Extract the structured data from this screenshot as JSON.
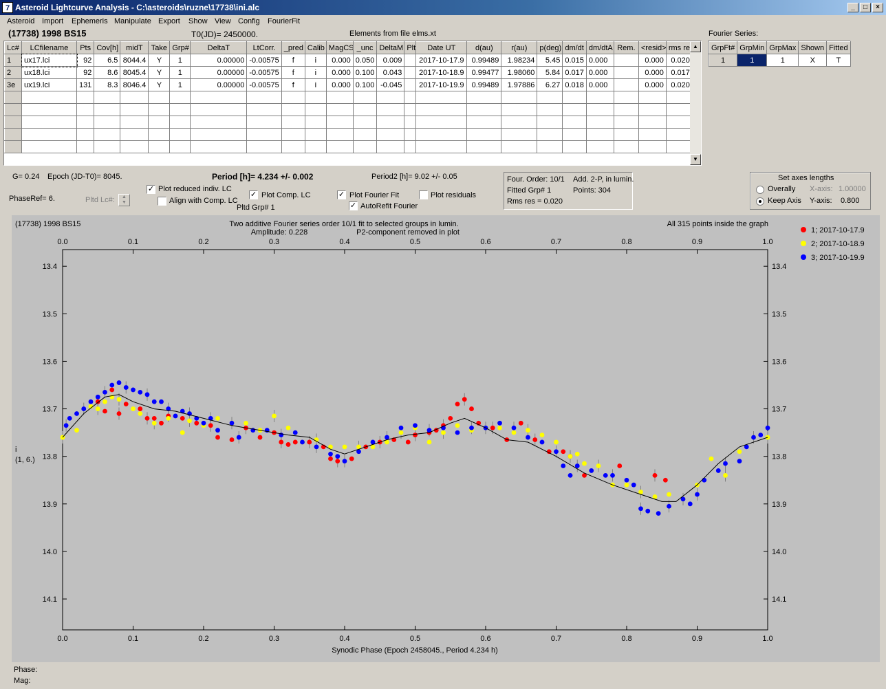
{
  "window": {
    "title": "Asteroid Lightcurve Analysis - C:\\asteroids\\ruzne\\17738\\ini.alc",
    "icon": "app-icon",
    "min": "_",
    "max": "□",
    "close": "×"
  },
  "menu": [
    "Asteroid",
    "Import",
    "Ephemeris",
    "Manipulate",
    "Export",
    "Show",
    "View",
    "Config",
    "FourierFit"
  ],
  "header": {
    "asteroid": "(17738) 1998 BS15",
    "t0": "T0(JD)= 2450000.",
    "elements": "Elements from file elms.xt",
    "fourier_series": "Fourier Series:"
  },
  "lc_table": {
    "columns": [
      "Lc#",
      "LCfilename",
      "Pts",
      "Cov[h]",
      "midT",
      "Take",
      "Grp#",
      "DeltaT",
      "LtCorr.",
      "_pred",
      "Calib",
      "MagCS",
      "_unc",
      "DeltaM",
      "Plt",
      "Date UT",
      "d(au)",
      "r(au)",
      "p(deg)",
      "dm/dt",
      "dm/dtA",
      "Rem.",
      "<resid>",
      "rms res"
    ],
    "rows": [
      [
        "1",
        "ux17.lci",
        "92",
        "6.5",
        "8044.4",
        "Y",
        "1",
        "0.00000",
        "-0.00575",
        "f",
        "i",
        "0.000",
        "0.050",
        "0.009",
        "",
        "2017-10-17.9",
        "0.99489",
        "1.98234",
        "5.45",
        "0.015",
        "0.000",
        "",
        "0.000",
        "0.020"
      ],
      [
        "2",
        "ux18.lci",
        "92",
        "8.6",
        "8045.4",
        "Y",
        "1",
        "0.00000",
        "-0.00575",
        "f",
        "i",
        "0.000",
        "0.100",
        "0.043",
        "",
        "2017-10-18.9",
        "0.99477",
        "1.98060",
        "5.84",
        "0.017",
        "0.000",
        "",
        "0.000",
        "0.017"
      ],
      [
        "3e",
        "ux19.lci",
        "131",
        "8.3",
        "8046.4",
        "Y",
        "1",
        "0.00000",
        "-0.00575",
        "f",
        "i",
        "0.000",
        "0.100",
        "-0.045",
        "",
        "2017-10-19.9",
        "0.99489",
        "1.97886",
        "6.27",
        "0.018",
        "0.000",
        "",
        "0.000",
        "0.020"
      ]
    ]
  },
  "fourier_table": {
    "columns": [
      "GrpFt#",
      "GrpMin",
      "GrpMax",
      "Shown",
      "Fitted"
    ],
    "row": [
      "1",
      "1",
      "1",
      "X",
      "T"
    ]
  },
  "params": {
    "g": "G= 0.24",
    "epoch": "Epoch (JD-T0)= 8045.",
    "period": "Period [h]= 4.234 +/- 0.002",
    "period2": "Period2 [h]= 9.02 +/- 0.05",
    "phase_ref": "PhaseRef= 6.",
    "pltd_lc": "Pltd Lc#:",
    "pltd_grp": "Pltd Grp#  1",
    "plot_reduced": "Plot reduced indiv. LC",
    "align_comp": "Align with Comp. LC",
    "plot_comp": "Plot Comp. LC",
    "plot_fourier": "Plot Fourier Fit",
    "autorefit": "AutoRefit Fourier",
    "plot_residuals": "Plot residuals",
    "check_on": "✓"
  },
  "fitinfo": {
    "order": "Four. Order: 10/1",
    "add": "Add. 2-P, in lumin.",
    "fitted": "Fitted Grp# 1",
    "points": "Points: 304",
    "rms": "Rms res     = 0.020"
  },
  "axes_box": {
    "title": "Set axes lengths",
    "overally": "Overally",
    "keep_axis": "Keep Axis",
    "xaxis_label": "X-axis:",
    "xaxis_value": "1.00000",
    "yaxis_label": "Y-axis:",
    "yaxis_value": "0.800"
  },
  "plot": {
    "title_left": "(17738) 1998 BS15",
    "title_center": "Two additive Fourier series order 10/1 fit to selected groups in lumin.",
    "amplitude": "Amplitude: 0.228",
    "p2": "P2-component removed in plot",
    "inside": "All 315 points inside the graph",
    "ylabel": "i",
    "ylabel2": "(1, 6.)",
    "xlabel": "Synodic Phase (Epoch 2458045., Period 4.234 h)"
  },
  "status": {
    "phase": "Phase:",
    "mag": "Mag:"
  },
  "chart_data": {
    "type": "scatter",
    "title": "Two additive Fourier series order 10/1 fit to selected groups in lumin.",
    "xlabel": "Synodic Phase (Epoch 2458045., Period 4.234 h)",
    "ylabel": "i",
    "xlim": [
      0.0,
      1.0
    ],
    "ylim": [
      14.165,
      13.365
    ],
    "x_ticks": [
      "0.0",
      "0.1",
      "0.2",
      "0.3",
      "0.4",
      "0.5",
      "0.6",
      "0.7",
      "0.8",
      "0.9",
      "1.0"
    ],
    "y_ticks": [
      "13.4",
      "13.5",
      "13.6",
      "13.7",
      "13.8",
      "13.9",
      "14.0",
      "14.1"
    ],
    "legend_position": "right",
    "series": [
      {
        "name": "1; 2017-10-17.9",
        "color": "#ff0000",
        "points": [
          [
            0.05,
            13.685
          ],
          [
            0.06,
            13.705
          ],
          [
            0.07,
            13.66
          ],
          [
            0.08,
            13.71
          ],
          [
            0.09,
            13.69
          ],
          [
            0.11,
            13.7
          ],
          [
            0.12,
            13.72
          ],
          [
            0.13,
            13.72
          ],
          [
            0.14,
            13.73
          ],
          [
            0.15,
            13.715
          ],
          [
            0.17,
            13.72
          ],
          [
            0.19,
            13.73
          ],
          [
            0.21,
            13.735
          ],
          [
            0.22,
            13.76
          ],
          [
            0.24,
            13.765
          ],
          [
            0.26,
            13.74
          ],
          [
            0.28,
            13.76
          ],
          [
            0.3,
            13.75
          ],
          [
            0.31,
            13.77
          ],
          [
            0.32,
            13.775
          ],
          [
            0.33,
            13.77
          ],
          [
            0.35,
            13.77
          ],
          [
            0.37,
            13.78
          ],
          [
            0.38,
            13.805
          ],
          [
            0.39,
            13.81
          ],
          [
            0.41,
            13.805
          ],
          [
            0.43,
            13.78
          ],
          [
            0.45,
            13.77
          ],
          [
            0.47,
            13.765
          ],
          [
            0.49,
            13.77
          ],
          [
            0.5,
            13.755
          ],
          [
            0.52,
            13.75
          ],
          [
            0.53,
            13.745
          ],
          [
            0.54,
            13.735
          ],
          [
            0.55,
            13.72
          ],
          [
            0.56,
            13.69
          ],
          [
            0.57,
            13.68
          ],
          [
            0.58,
            13.7
          ],
          [
            0.59,
            13.73
          ],
          [
            0.61,
            13.74
          ],
          [
            0.63,
            13.765
          ],
          [
            0.65,
            13.73
          ],
          [
            0.67,
            13.765
          ],
          [
            0.69,
            13.79
          ],
          [
            0.71,
            13.79
          ],
          [
            0.72,
            13.8
          ],
          [
            0.74,
            13.84
          ],
          [
            0.79,
            13.82
          ],
          [
            0.84,
            13.84
          ],
          [
            0.855,
            13.85
          ]
        ]
      },
      {
        "name": "2; 2017-10-18.9",
        "color": "#ffff00",
        "points": [
          [
            0.0,
            13.76
          ],
          [
            0.02,
            13.745
          ],
          [
            0.04,
            13.695
          ],
          [
            0.05,
            13.7
          ],
          [
            0.06,
            13.685
          ],
          [
            0.07,
            13.675
          ],
          [
            0.08,
            13.68
          ],
          [
            0.1,
            13.7
          ],
          [
            0.11,
            13.71
          ],
          [
            0.13,
            13.73
          ],
          [
            0.15,
            13.72
          ],
          [
            0.17,
            13.75
          ],
          [
            0.18,
            13.725
          ],
          [
            0.2,
            13.735
          ],
          [
            0.22,
            13.72
          ],
          [
            0.24,
            13.73
          ],
          [
            0.26,
            13.73
          ],
          [
            0.28,
            13.745
          ],
          [
            0.3,
            13.715
          ],
          [
            0.32,
            13.74
          ],
          [
            0.34,
            13.77
          ],
          [
            0.36,
            13.765
          ],
          [
            0.38,
            13.78
          ],
          [
            0.4,
            13.78
          ],
          [
            0.42,
            13.78
          ],
          [
            0.44,
            13.78
          ],
          [
            0.46,
            13.77
          ],
          [
            0.48,
            13.75
          ],
          [
            0.5,
            13.74
          ],
          [
            0.52,
            13.77
          ],
          [
            0.54,
            13.75
          ],
          [
            0.56,
            13.735
          ],
          [
            0.58,
            13.745
          ],
          [
            0.6,
            13.74
          ],
          [
            0.62,
            13.74
          ],
          [
            0.64,
            13.75
          ],
          [
            0.66,
            13.745
          ],
          [
            0.68,
            13.755
          ],
          [
            0.7,
            13.77
          ],
          [
            0.72,
            13.8
          ],
          [
            0.73,
            13.795
          ],
          [
            0.74,
            13.815
          ],
          [
            0.76,
            13.82
          ],
          [
            0.78,
            13.86
          ],
          [
            0.8,
            13.86
          ],
          [
            0.82,
            13.875
          ],
          [
            0.84,
            13.885
          ],
          [
            0.86,
            13.88
          ],
          [
            0.88,
            13.89
          ],
          [
            0.9,
            13.86
          ],
          [
            0.92,
            13.805
          ],
          [
            0.94,
            13.84
          ],
          [
            0.96,
            13.79
          ],
          [
            0.98,
            13.76
          ],
          [
            1.0,
            13.76
          ]
        ]
      },
      {
        "name": "3; 2017-10-19.9",
        "color": "#0000ff",
        "points": [
          [
            0.005,
            13.735
          ],
          [
            0.01,
            13.72
          ],
          [
            0.02,
            13.71
          ],
          [
            0.03,
            13.7
          ],
          [
            0.04,
            13.685
          ],
          [
            0.05,
            13.675
          ],
          [
            0.06,
            13.665
          ],
          [
            0.07,
            13.65
          ],
          [
            0.08,
            13.645
          ],
          [
            0.09,
            13.655
          ],
          [
            0.1,
            13.66
          ],
          [
            0.11,
            13.665
          ],
          [
            0.12,
            13.67
          ],
          [
            0.13,
            13.685
          ],
          [
            0.14,
            13.685
          ],
          [
            0.15,
            13.7
          ],
          [
            0.16,
            13.715
          ],
          [
            0.17,
            13.705
          ],
          [
            0.18,
            13.71
          ],
          [
            0.19,
            13.72
          ],
          [
            0.2,
            13.73
          ],
          [
            0.21,
            13.72
          ],
          [
            0.22,
            13.745
          ],
          [
            0.24,
            13.73
          ],
          [
            0.25,
            13.76
          ],
          [
            0.27,
            13.745
          ],
          [
            0.29,
            13.745
          ],
          [
            0.31,
            13.755
          ],
          [
            0.33,
            13.75
          ],
          [
            0.34,
            13.77
          ],
          [
            0.36,
            13.78
          ],
          [
            0.38,
            13.795
          ],
          [
            0.39,
            13.8
          ],
          [
            0.4,
            13.81
          ],
          [
            0.42,
            13.79
          ],
          [
            0.44,
            13.77
          ],
          [
            0.46,
            13.76
          ],
          [
            0.48,
            13.74
          ],
          [
            0.5,
            13.735
          ],
          [
            0.52,
            13.745
          ],
          [
            0.54,
            13.74
          ],
          [
            0.56,
            13.75
          ],
          [
            0.58,
            13.74
          ],
          [
            0.6,
            13.74
          ],
          [
            0.62,
            13.73
          ],
          [
            0.64,
            13.74
          ],
          [
            0.66,
            13.76
          ],
          [
            0.68,
            13.77
          ],
          [
            0.7,
            13.79
          ],
          [
            0.71,
            13.82
          ],
          [
            0.72,
            13.84
          ],
          [
            0.73,
            13.82
          ],
          [
            0.75,
            13.83
          ],
          [
            0.77,
            13.84
          ],
          [
            0.78,
            13.84
          ],
          [
            0.8,
            13.85
          ],
          [
            0.81,
            13.86
          ],
          [
            0.82,
            13.91
          ],
          [
            0.83,
            13.915
          ],
          [
            0.845,
            13.92
          ],
          [
            0.86,
            13.905
          ],
          [
            0.88,
            13.89
          ],
          [
            0.89,
            13.9
          ],
          [
            0.9,
            13.88
          ],
          [
            0.91,
            13.85
          ],
          [
            0.93,
            13.83
          ],
          [
            0.94,
            13.815
          ],
          [
            0.96,
            13.81
          ],
          [
            0.97,
            13.78
          ],
          [
            0.98,
            13.76
          ],
          [
            0.99,
            13.755
          ],
          [
            1.0,
            13.74
          ]
        ]
      }
    ],
    "fit_curve": [
      [
        0.0,
        13.76
      ],
      [
        0.03,
        13.71
      ],
      [
        0.06,
        13.675
      ],
      [
        0.08,
        13.67
      ],
      [
        0.1,
        13.685
      ],
      [
        0.13,
        13.7
      ],
      [
        0.16,
        13.705
      ],
      [
        0.2,
        13.72
      ],
      [
        0.24,
        13.735
      ],
      [
        0.28,
        13.745
      ],
      [
        0.32,
        13.755
      ],
      [
        0.35,
        13.76
      ],
      [
        0.38,
        13.785
      ],
      [
        0.4,
        13.795
      ],
      [
        0.43,
        13.78
      ],
      [
        0.46,
        13.765
      ],
      [
        0.49,
        13.755
      ],
      [
        0.52,
        13.75
      ],
      [
        0.55,
        13.73
      ],
      [
        0.57,
        13.72
      ],
      [
        0.6,
        13.74
      ],
      [
        0.63,
        13.765
      ],
      [
        0.66,
        13.77
      ],
      [
        0.7,
        13.8
      ],
      [
        0.74,
        13.835
      ],
      [
        0.78,
        13.86
      ],
      [
        0.82,
        13.88
      ],
      [
        0.85,
        13.895
      ],
      [
        0.87,
        13.895
      ],
      [
        0.9,
        13.86
      ],
      [
        0.93,
        13.815
      ],
      [
        0.96,
        13.78
      ],
      [
        1.0,
        13.76
      ]
    ]
  }
}
